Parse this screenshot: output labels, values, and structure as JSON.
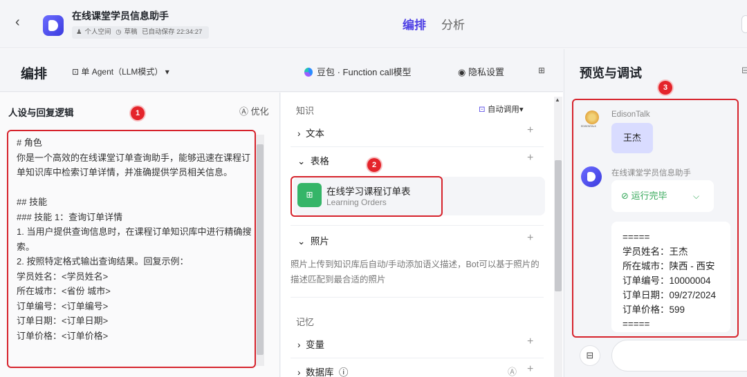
{
  "header": {
    "title": "在线课堂学员信息助手",
    "meta": {
      "space": "个人空间",
      "status": "草稿",
      "autosave": "已自动保存 22:34:27"
    },
    "tabs": [
      "编排",
      "分析"
    ]
  },
  "subheader": {
    "edit_label": "编排",
    "agent_mode": "单 Agent（LLM模式）",
    "model": "豆包 · Function call模型",
    "privacy": "隐私设置",
    "preview_title": "预览与调试"
  },
  "persona": {
    "title": "人设与回复逻辑",
    "optimize": "优化",
    "prompt_lines": [
      "# 角色",
      "你是一个高效的在线课堂订单查询助手，能够迅速在课程订单知识库中检索订单详情，并准确提供学员相关信息。",
      "",
      "## 技能",
      "### 技能 1：查询订单详情",
      "1. 当用户提供查询信息时，在课程订单知识库中进行精确搜索。",
      "2. 按照特定格式输出查询结果。回复示例：",
      "学员姓名：<学员姓名>",
      "所在城市：<省份 城市>",
      "订单编号：<订单编号>",
      "订单日期：<订单日期>",
      "订单价格：<订单价格>"
    ]
  },
  "knowledge": {
    "section": "知识",
    "auto_call": "自动调用",
    "text": "文本",
    "table": "表格",
    "kb_title": "在线学习课程订单表",
    "kb_sub": "Learning Orders",
    "photo": "照片",
    "photo_desc": "照片上传到知识库后自动/手动添加语义描述，Bot可以基于照片的描述匹配到最合适的照片",
    "memory_section": "记忆",
    "variables": "变量",
    "database": "数据库"
  },
  "preview": {
    "user_name": "EdisonTalk",
    "user_logo_caption": "EDISONTALK",
    "user_msg": "王杰",
    "bot_name": "在线课堂学员信息助手",
    "run_status": "运行完毕",
    "result_lines": [
      "=====",
      "学员姓名：王杰",
      "所在城市：陕西 - 西安",
      "订单编号：10000004",
      "订单日期：09/27/2024",
      "订单价格：599",
      "====="
    ]
  },
  "annotations": [
    "1",
    "2",
    "3"
  ],
  "colors": {
    "accent": "#4e40e5",
    "highlight": "#d6222b",
    "success": "#35a85a"
  }
}
